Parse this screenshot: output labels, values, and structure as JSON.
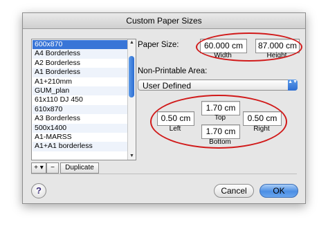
{
  "window": {
    "title": "Custom Paper Sizes"
  },
  "paper_list": {
    "items": [
      "600x870",
      "A4 Borderless",
      "A2 Borderless",
      "A1 Borderless",
      "A1+210mm",
      "GUM_plan",
      "61x110 DJ 450",
      "610x870",
      "A3 Borderless",
      "500x1400",
      "A1-MARSS",
      "A1+A1 borderless"
    ],
    "selected_index": 0,
    "scroll_up_glyph": "▲",
    "scroll_down_glyph": "▼"
  },
  "list_controls": {
    "add_label": "+ ▾",
    "remove_label": "−",
    "duplicate_label": "Duplicate"
  },
  "paper_size": {
    "label": "Paper Size:",
    "width_value": "60.000 cm",
    "width_caption": "Width",
    "height_value": "87.000 cm",
    "height_caption": "Height"
  },
  "non_printable": {
    "label": "Non-Printable Area:",
    "selected_option": "User Defined",
    "popup_glyph": "▲▼",
    "top_value": "1.70 cm",
    "top_caption": "Top",
    "left_value": "0.50 cm",
    "left_caption": "Left",
    "right_value": "0.50 cm",
    "right_caption": "Right",
    "bottom_value": "1.70 cm",
    "bottom_caption": "Bottom"
  },
  "footer": {
    "help_label": "?",
    "cancel_label": "Cancel",
    "ok_label": "OK"
  },
  "colors": {
    "annotation": "#d11a1a",
    "selection": "#3875d7",
    "accent": "#4c8ee4"
  }
}
